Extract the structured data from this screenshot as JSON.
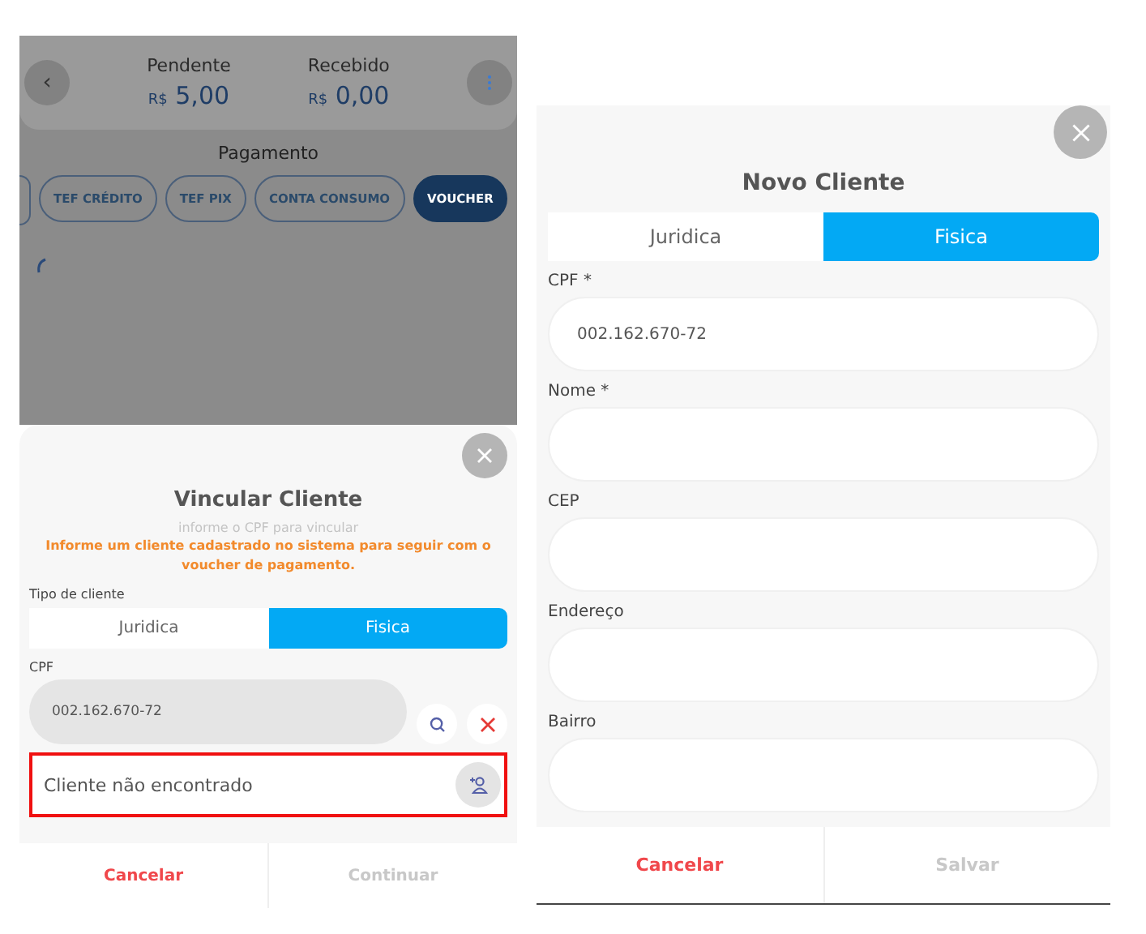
{
  "left_screen": {
    "header": {
      "back_icon": "‹",
      "pending": {
        "label": "Pendente",
        "currency": "R$",
        "amount": "5,00"
      },
      "received": {
        "label": "Recebido",
        "currency": "R$",
        "amount": "0,00"
      }
    },
    "payment": {
      "title": "Pagamento",
      "methods": [
        {
          "label": "TEF CRÉDITO",
          "selected": false
        },
        {
          "label": "TEF PIX",
          "selected": false
        },
        {
          "label": "CONTA CONSUMO",
          "selected": false
        },
        {
          "label": "VOUCHER",
          "selected": true
        }
      ]
    },
    "dialog": {
      "title": "Vincular Cliente",
      "subtitle": "informe o CPF para vincular",
      "warning": "Informe um cliente cadastrado no sistema para seguir com o voucher de pagamento.",
      "client_type_label": "Tipo de cliente",
      "client_types": [
        {
          "label": "Juridica",
          "selected": false
        },
        {
          "label": "Fisica",
          "selected": true
        }
      ],
      "cpf_label": "CPF",
      "cpf_value": "002.162.670-72",
      "result": "Cliente não encontrado",
      "result_error": true
    },
    "buttons": [
      {
        "label": "Cancelar",
        "disabled": false
      },
      {
        "label": "Continuar",
        "disabled": true
      }
    ]
  },
  "right_screen": {
    "title": "Novo Cliente",
    "client_types": [
      {
        "label": "Juridica",
        "selected": false
      },
      {
        "label": "Fisica",
        "selected": true
      }
    ],
    "fields": [
      {
        "label": "CPF *",
        "value": "002.162.670-72"
      },
      {
        "label": "Nome *"
      },
      {
        "label": "CEP"
      },
      {
        "label": "Endereço"
      },
      {
        "label": "Bairro"
      }
    ],
    "buttons": [
      {
        "label": "Cancelar",
        "disabled": false
      },
      {
        "label": "Salvar",
        "disabled": true
      }
    ]
  }
}
